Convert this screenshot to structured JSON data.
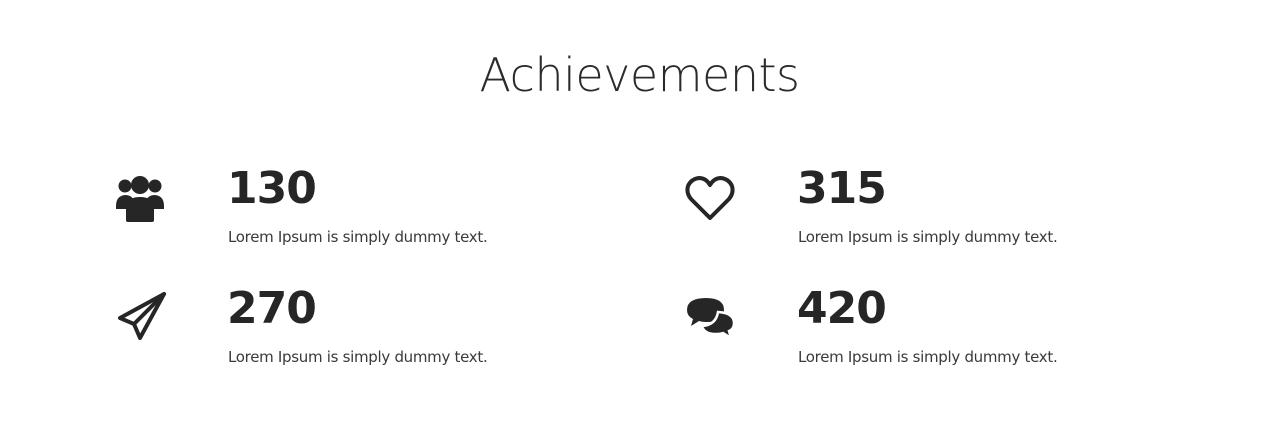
{
  "section": {
    "title": "Achievements"
  },
  "achievements": [
    {
      "icon": "users-icon",
      "number": "130",
      "text": "Lorem Ipsum is simply dummy text."
    },
    {
      "icon": "heart-icon",
      "number": "315",
      "text": "Lorem Ipsum is simply dummy text."
    },
    {
      "icon": "paper-plane-icon",
      "number": "270",
      "text": "Lorem Ipsum is simply dummy text."
    },
    {
      "icon": "comments-icon",
      "number": "420",
      "text": "Lorem Ipsum is simply dummy text."
    }
  ],
  "colors": {
    "text": "#2b2b2b",
    "background": "#ffffff"
  }
}
